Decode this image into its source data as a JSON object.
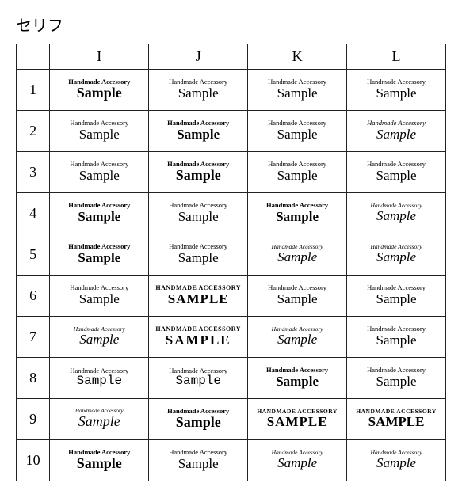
{
  "title": "セリフ",
  "columns": [
    "I",
    "J",
    "K",
    "L"
  ],
  "top_text": "Handmade Accessory",
  "bottom_text": "Sample",
  "rows": [
    {
      "num": "1",
      "cells": [
        {
          "top": "Handmade Accessory",
          "bottom": "Sample",
          "topClass": "s-i1-top",
          "botClass": "s-i1-bot"
        },
        {
          "top": "Handmade Accessory",
          "bottom": "Sample",
          "topClass": "s-j1-top",
          "botClass": "s-j1-bot"
        },
        {
          "top": "Handmade Accessory",
          "bottom": "Sample",
          "topClass": "s-k1-top",
          "botClass": "s-k1-bot"
        },
        {
          "top": "Handmade Accessory",
          "bottom": "Sample",
          "topClass": "s-l1-top",
          "botClass": "s-l1-bot"
        }
      ]
    },
    {
      "num": "2",
      "cells": [
        {
          "top": "Handmade Accessory",
          "bottom": "Sample",
          "topClass": "s-i2-top",
          "botClass": "s-i2-bot"
        },
        {
          "top": "Handmade Accessory",
          "bottom": "Sample",
          "topClass": "s-j2-top",
          "botClass": "s-j2-bot"
        },
        {
          "top": "Handmade Accessory",
          "bottom": "Sample",
          "topClass": "s-k2-top",
          "botClass": "s-k2-bot"
        },
        {
          "top": "Handmade Accessory",
          "bottom": "Sample",
          "topClass": "s-l2-top",
          "botClass": "s-l2-bot"
        }
      ]
    },
    {
      "num": "3",
      "cells": [
        {
          "top": "Handmade Accessory",
          "bottom": "Sample",
          "topClass": "s-i3-top",
          "botClass": "s-i3-bot"
        },
        {
          "top": "Handmade Accessory",
          "bottom": "Sample",
          "topClass": "s-j3-top",
          "botClass": "s-j3-bot"
        },
        {
          "top": "Handmade Accessory",
          "bottom": "Sample",
          "topClass": "s-k3-top",
          "botClass": "s-k3-bot"
        },
        {
          "top": "Handmade Accessory",
          "bottom": "Sample",
          "topClass": "s-l3-top",
          "botClass": "s-l3-bot"
        }
      ]
    },
    {
      "num": "4",
      "cells": [
        {
          "top": "Handmade Accessory",
          "bottom": "Sample",
          "topClass": "s-i4-top",
          "botClass": "s-i4-bot"
        },
        {
          "top": "Handmade Accessory",
          "bottom": "Sample",
          "topClass": "s-j4-top",
          "botClass": "s-j4-bot"
        },
        {
          "top": "Handmade Accessory",
          "bottom": "Sample",
          "topClass": "s-k4-top",
          "botClass": "s-k4-bot"
        },
        {
          "top": "Handmade Accessory",
          "bottom": "Sample",
          "topClass": "s-l4-top",
          "botClass": "s-l4-bot"
        }
      ]
    },
    {
      "num": "5",
      "cells": [
        {
          "top": "Handmade Accessory",
          "bottom": "Sample",
          "topClass": "s-i5-top",
          "botClass": "s-i5-bot"
        },
        {
          "top": "Handmade Accessory",
          "bottom": "Sample",
          "topClass": "s-j5-top",
          "botClass": "s-j5-bot"
        },
        {
          "top": "Handmade Accessory",
          "bottom": "Sample",
          "topClass": "s-k5-top",
          "botClass": "s-k5-bot"
        },
        {
          "top": "Handmade Accessory",
          "bottom": "Sample",
          "topClass": "s-l5-top",
          "botClass": "s-l5-bot"
        }
      ]
    },
    {
      "num": "6",
      "cells": [
        {
          "top": "Handmade Accessory",
          "bottom": "Sample",
          "topClass": "s-i6-top",
          "botClass": "s-i6-bot"
        },
        {
          "top": "HANDMADE ACCESSORY",
          "bottom": "SAMPLE",
          "topClass": "s-j6-top",
          "botClass": "s-j6-bot"
        },
        {
          "top": "Handmade Accessory",
          "bottom": "Sample",
          "topClass": "s-k6-top",
          "botClass": "s-k6-bot"
        },
        {
          "top": "Handmade Accessory",
          "bottom": "Sample",
          "topClass": "s-l6-top",
          "botClass": "s-l6-bot"
        }
      ]
    },
    {
      "num": "7",
      "cells": [
        {
          "top": "Handmade Accessory",
          "bottom": "Sample",
          "topClass": "s-i7-top",
          "botClass": "s-i7-bot"
        },
        {
          "top": "HANDMADE ACCESSORY",
          "bottom": "SAMPLE",
          "topClass": "s-j7-top",
          "botClass": "s-j7-bot"
        },
        {
          "top": "Handmade Accessory",
          "bottom": "Sample",
          "topClass": "s-k7-top",
          "botClass": "s-k7-bot"
        },
        {
          "top": "Handmade Accessory",
          "bottom": "Sample",
          "topClass": "s-l7-top",
          "botClass": "s-l7-bot"
        }
      ]
    },
    {
      "num": "8",
      "cells": [
        {
          "top": "Handmade Accessory",
          "bottom": "Sample",
          "topClass": "s-i8-top",
          "botClass": "s-i8-bot"
        },
        {
          "top": "Handmade Accessory",
          "bottom": "Sample",
          "topClass": "s-j8-top",
          "botClass": "s-j8-bot"
        },
        {
          "top": "Handmade Accessory",
          "bottom": "Sample",
          "topClass": "s-k8-top",
          "botClass": "s-k8-bot"
        },
        {
          "top": "Handmade Accessory",
          "bottom": "Sample",
          "topClass": "s-l8-top",
          "botClass": "s-l8-bot"
        }
      ]
    },
    {
      "num": "9",
      "cells": [
        {
          "top": "Handmade Accessory",
          "bottom": "Sample",
          "topClass": "s-i9-top",
          "botClass": "s-i9-bot"
        },
        {
          "top": "Handmade Accessory",
          "bottom": "Sample",
          "topClass": "s-j9-top",
          "botClass": "s-j9-bot"
        },
        {
          "top": "HANDMADE ACCESSORY",
          "bottom": "SAMPLE",
          "topClass": "s-k9-top",
          "botClass": "s-k9-bot"
        },
        {
          "top": "HANDMADE ACCESSORY",
          "bottom": "SAMPLE",
          "topClass": "s-l9-top",
          "botClass": "s-l9-bot"
        }
      ]
    },
    {
      "num": "10",
      "cells": [
        {
          "top": "Handmade Accessory",
          "bottom": "Sample",
          "topClass": "s-i10-top",
          "botClass": "s-i10-bot"
        },
        {
          "top": "Handmade Accessory",
          "bottom": "Sample",
          "topClass": "s-j10-top",
          "botClass": "s-j10-bot"
        },
        {
          "top": "Handmade Accessory",
          "bottom": "Sample",
          "topClass": "s-k10-top",
          "botClass": "s-k10-bot"
        },
        {
          "top": "Handmade Accessory",
          "bottom": "Sample",
          "topClass": "s-l10-top",
          "botClass": "s-l10-bot"
        }
      ]
    }
  ]
}
